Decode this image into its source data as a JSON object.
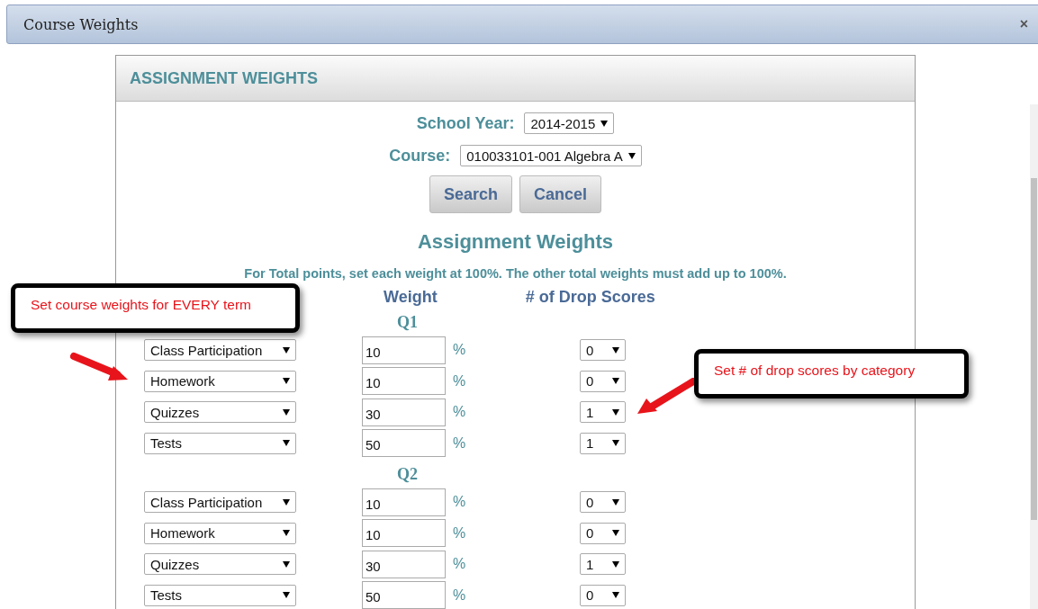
{
  "dialog": {
    "title": "Course Weights",
    "close": "×"
  },
  "panel": {
    "heading": "ASSIGNMENT WEIGHTS",
    "filters": [
      {
        "label": "School Year:",
        "value": "2014-2015"
      },
      {
        "label": "Course:",
        "value": "010033101-001 Algebra A"
      }
    ],
    "buttons": [
      "Search",
      "Cancel"
    ],
    "title": "Assignment Weights",
    "note": "For Total points, set each weight at 100%. The other total weights must add up to 100%.",
    "columns": [
      "Weight",
      "# of Drop Scores"
    ],
    "terms": [
      {
        "name": "Q1",
        "rows": [
          {
            "category": "Class Participation",
            "weight": "10",
            "unit": "%",
            "drops": "0"
          },
          {
            "category": "Homework",
            "weight": "10",
            "unit": "%",
            "drops": "0"
          },
          {
            "category": "Quizzes",
            "weight": "30",
            "unit": "%",
            "drops": "1"
          },
          {
            "category": "Tests",
            "weight": "50",
            "unit": "%",
            "drops": "1"
          }
        ]
      },
      {
        "name": "Q2",
        "rows": [
          {
            "category": "Class Participation",
            "weight": "10",
            "unit": "%",
            "drops": "0"
          },
          {
            "category": "Homework",
            "weight": "10",
            "unit": "%",
            "drops": "0"
          },
          {
            "category": "Quizzes",
            "weight": "30",
            "unit": "%",
            "drops": "1"
          },
          {
            "category": "Tests",
            "weight": "50",
            "unit": "%",
            "drops": "0"
          }
        ]
      }
    ]
  },
  "callouts": [
    {
      "text": "Set course weights for EVERY term"
    },
    {
      "text": "Set # of drop scores by category"
    }
  ]
}
